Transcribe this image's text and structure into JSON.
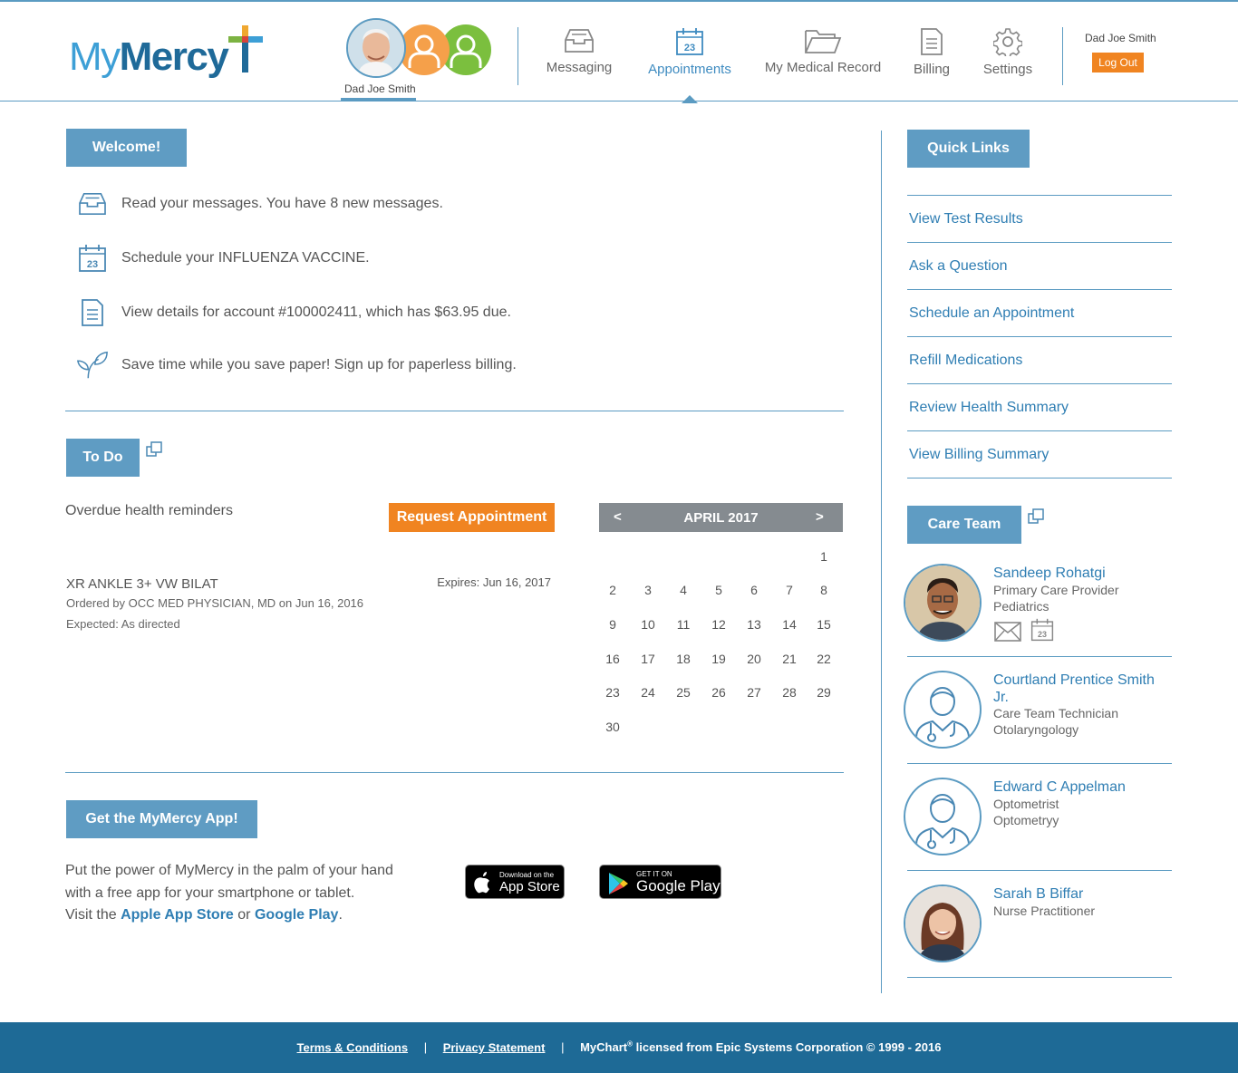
{
  "header": {
    "logo_my": "My",
    "logo_mercy": "Mercy",
    "active_user": "Dad Joe Smith",
    "nav": [
      {
        "label": "Messaging",
        "icon": "inbox-icon"
      },
      {
        "label": "Appointments",
        "icon": "calendar-icon"
      },
      {
        "label": "My Medical Record",
        "icon": "folder-icon"
      },
      {
        "label": "Billing",
        "icon": "document-icon"
      },
      {
        "label": "Settings",
        "icon": "gear-icon"
      }
    ],
    "account_name": "Dad Joe Smith",
    "logout_label": "Log Out"
  },
  "welcome": {
    "title": "Welcome!",
    "items": [
      {
        "icon": "inbox-icon",
        "text": "Read your messages. You have 8 new messages."
      },
      {
        "icon": "calendar-icon",
        "text": "Schedule your INFLUENZA VACCINE."
      },
      {
        "icon": "document-icon",
        "text": "View details for account #100002411, which has $63.95 due."
      },
      {
        "icon": "leaf-icon",
        "text": "Save time while you save paper! Sign up for paperless billing."
      }
    ]
  },
  "todo": {
    "title": "To Do",
    "overdue_label": "Overdue health reminders",
    "request_btn": "Request Appointment",
    "reminder": {
      "title": "XR ANKLE 3+ VW BILAT",
      "ordered_by": "Ordered by OCC MED PHYSICIAN, MD on Jun 16, 2016",
      "expected": "Expected: As directed",
      "expires": "Expires: Jun 16, 2017"
    }
  },
  "calendar": {
    "month": "APRIL 2017",
    "prev": "<",
    "next": ">",
    "weeks": [
      [
        "",
        "",
        "",
        "",
        "",
        "",
        "1"
      ],
      [
        "2",
        "3",
        "4",
        "5",
        "6",
        "7",
        "8"
      ],
      [
        "9",
        "10",
        "11",
        "12",
        "13",
        "14",
        "15"
      ],
      [
        "16",
        "17",
        "18",
        "19",
        "20",
        "21",
        "22"
      ],
      [
        "23",
        "24",
        "25",
        "26",
        "27",
        "28",
        "29"
      ],
      [
        "30",
        "",
        "",
        "",
        "",
        "",
        ""
      ]
    ]
  },
  "app": {
    "title": "Get the MyMercy App!",
    "line1": "Put the power of MyMercy in the palm of your hand",
    "line2": "with a free app for your smartphone or tablet.",
    "visit": "Visit the",
    "apple_link": "Apple App Store",
    "or": "or",
    "google_link": "Google Play",
    "period": ".",
    "appstore_small": "Download on the",
    "appstore_big": "App Store",
    "play_small": "GET IT ON",
    "play_big": "Google Play"
  },
  "quick_links": {
    "title": "Quick Links",
    "items": [
      "View Test Results",
      "Ask a Question",
      "Schedule an Appointment",
      "Refill Medications",
      "Review Health Summary",
      "View Billing Summary"
    ]
  },
  "care_team": {
    "title": "Care Team",
    "members": [
      {
        "name": "Sandeep Rohatgi",
        "role": "Primary Care Provider",
        "specialty": "Pediatrics"
      },
      {
        "name_line1": "Courtland Prentice Smith",
        "name_line2": "Jr.",
        "role": "Care Team Technician",
        "specialty": "Otolaryngology"
      },
      {
        "name": "Edward C Appelman",
        "role": "Optometrist",
        "specialty": "Optometryy"
      },
      {
        "name": "Sarah B Biffar",
        "role": "Nurse Practitioner"
      }
    ]
  },
  "footer": {
    "terms": "Terms & Conditions",
    "sep": "|",
    "privacy": "Privacy Statement",
    "license_pre": "MyChart",
    "license_reg": "®",
    "license_post": " licensed from Epic Systems Corporation © 1999 - 2016"
  },
  "colors": {
    "brand_blue": "#5f9cc3",
    "link_blue": "#2f7eb3",
    "orange": "#f08421",
    "footer_bg": "#1e6a96"
  }
}
